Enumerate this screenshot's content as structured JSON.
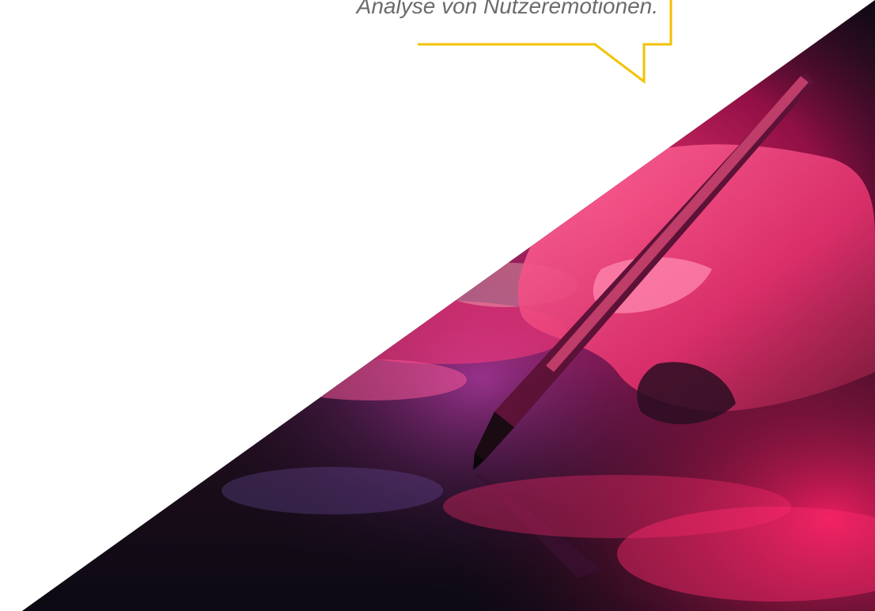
{
  "quote": {
    "text": "Analyse von Nutzeremotionen."
  },
  "colors": {
    "bubble_border": "#f2c200",
    "quote_text": "#6b6b6b",
    "background": "#ffffff",
    "photo_dark": "#0d0a18",
    "photo_pink": "#ff2a6d",
    "photo_magenta": "#e0187a",
    "photo_purple": "#5a2a8a"
  },
  "photo": {
    "subject": "hand holding stylus pen on reflective surface"
  }
}
